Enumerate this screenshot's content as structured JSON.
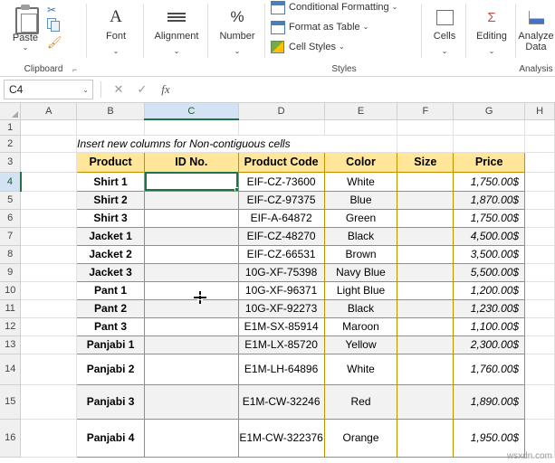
{
  "ribbon": {
    "groups": [
      {
        "name": "Clipboard",
        "label": "Clipboard"
      },
      {
        "name": "Font",
        "label": "Font"
      },
      {
        "name": "Alignment",
        "label": "Alignment"
      },
      {
        "name": "Number",
        "label": "Number"
      },
      {
        "name": "Styles",
        "label": "Styles"
      },
      {
        "name": "Cells",
        "label": "Cells"
      },
      {
        "name": "Editing",
        "label": "Editing"
      },
      {
        "name": "Analysis",
        "label": "Analysis"
      }
    ],
    "paste": {
      "label": "Paste",
      "caret": "⌄"
    },
    "cut_icon": "scissors-icon",
    "copy_icon": "copy-icon",
    "format_painter_icon": "format-painter-icon",
    "clipboard_dialog_launcher": "⌐",
    "font": {
      "label": "Font",
      "caret": "⌄",
      "icon": "A"
    },
    "alignment": {
      "label": "Alignment",
      "caret": "⌄"
    },
    "number": {
      "label": "Number",
      "caret": "⌄",
      "icon": "%"
    },
    "styles": {
      "conditional_formatting": "Conditional Formatting",
      "format_as_table": "Format as Table",
      "cell_styles": "Cell Styles",
      "caret": "⌄"
    },
    "cells": {
      "label": "Cells",
      "caret": "⌄"
    },
    "editing": {
      "label": "Editing",
      "caret": "⌄"
    },
    "analysis": {
      "label": "Analyze Data",
      "line1": "Analyze",
      "line2": "Data"
    }
  },
  "formula_bar": {
    "name_box_value": "C4",
    "name_box_caret": "⌄",
    "cancel": "✕",
    "enter": "✓",
    "fx": "fx",
    "formula_value": "",
    "formula_placeholder": ""
  },
  "grid": {
    "column_headers": [
      "A",
      "B",
      "C",
      "D",
      "E",
      "F",
      "G",
      "H"
    ],
    "selected_column": "C",
    "row_headers": [
      "1",
      "2",
      "3",
      "4",
      "5",
      "6",
      "7",
      "8",
      "9",
      "10",
      "11",
      "12",
      "13",
      "14",
      "15",
      "16"
    ],
    "selected_row": "4",
    "note": "Insert new columns for Non-contiguous cells",
    "table_headers": [
      "Product",
      "ID No.",
      "Product Code",
      "Color",
      "Size",
      "Price"
    ],
    "rows": [
      {
        "product": "Shirt 1",
        "id": "",
        "code": "EIF-CZ-73600",
        "color": "White",
        "size": "",
        "price": "1,750.00$"
      },
      {
        "product": "Shirt 2",
        "id": "",
        "code": "EIF-CZ-97375",
        "color": "Blue",
        "size": "",
        "price": "1,870.00$"
      },
      {
        "product": "Shirt 3",
        "id": "",
        "code": "EIF-A-64872",
        "color": "Green",
        "size": "",
        "price": "1,750.00$"
      },
      {
        "product": "Jacket 1",
        "id": "",
        "code": "EIF-CZ-48270",
        "color": "Black",
        "size": "",
        "price": "4,500.00$"
      },
      {
        "product": "Jacket 2",
        "id": "",
        "code": "EIF-CZ-66531",
        "color": "Brown",
        "size": "",
        "price": "3,500.00$"
      },
      {
        "product": "Jacket 3",
        "id": "",
        "code": "10G-XF-75398",
        "color": "Navy Blue",
        "size": "",
        "price": "5,500.00$"
      },
      {
        "product": "Pant 1",
        "id": "",
        "code": "10G-XF-96371",
        "color": "Light Blue",
        "size": "",
        "price": "1,200.00$"
      },
      {
        "product": "Pant 2",
        "id": "",
        "code": "10G-XF-92273",
        "color": "Black",
        "size": "",
        "price": "1,230.00$"
      },
      {
        "product": "Pant 3",
        "id": "",
        "code": "E1M-SX-85914",
        "color": "Maroon",
        "size": "",
        "price": "1,100.00$"
      },
      {
        "product": "Panjabi 1",
        "id": "",
        "code": "E1M-LX-85720",
        "color": "Yellow",
        "size": "",
        "price": "2,300.00$"
      },
      {
        "product": "Panjabi 2",
        "id": "",
        "code": "E1M-LH-64896",
        "color": "White",
        "size": "",
        "price": "1,760.00$"
      },
      {
        "product": "Panjabi 3",
        "id": "",
        "code": "E1M-CW-32246",
        "color": "Red",
        "size": "",
        "price": "1,890.00$"
      },
      {
        "product": "Panjabi 4",
        "id": "",
        "code": "E1M-CW-322376",
        "color": "Orange",
        "size": "",
        "price": "1,950.00$"
      }
    ],
    "watermark": "wsxdn.com"
  },
  "colors": {
    "header_fill": "#ffe699",
    "header_border": "#bf9000",
    "band": "#f2f2f2",
    "selection": "#217346",
    "header_sel_fill": "#d3e3f3"
  }
}
